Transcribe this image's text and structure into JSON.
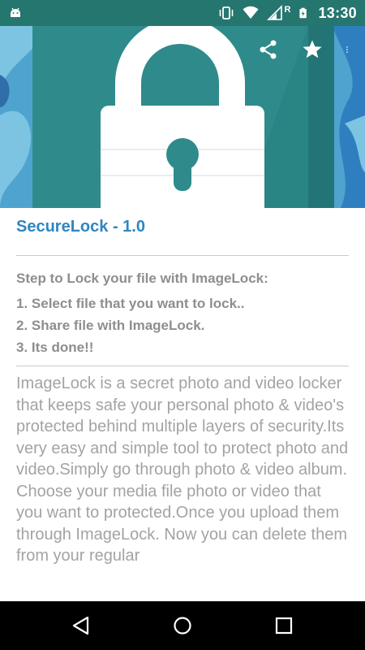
{
  "status_bar": {
    "time": "13:30",
    "icons": [
      "android-debug-icon",
      "vibrate-icon",
      "wifi-icon",
      "signal-icon",
      "roaming-r-label",
      "battery-charging-icon"
    ],
    "roaming_label": "R"
  },
  "header": {
    "background_colors": {
      "sky": "#5fb1d4",
      "panel": "#2a8a86",
      "lock": "#ffffff",
      "keyhole": "#2a8a86"
    },
    "actions": [
      "share-icon",
      "star-icon",
      "more-vert-icon"
    ]
  },
  "content": {
    "title": "SecureLock - 1.0",
    "steps_heading": "Step to Lock your file with ImageLock:",
    "steps": [
      "1. Select file that you want to lock..",
      "2. Share file with ImageLock.",
      "3. Its done!!"
    ],
    "description": [
      "ImageLock is a secret photo and video locker that keeps safe your personal photo & video's protected behind multiple layers of security.Its very easy and simple tool to protect photo and video.Simply go through photo & video album.",
      "Choose your media file photo or video that you want to protected.Once you upload them through ImageLock. Now you can delete them from your regular"
    ]
  },
  "colors": {
    "status_bar": "#25766f",
    "title": "#2f86c0",
    "text_gray": "#8e8e8e",
    "desc_gray": "#a3a3a3",
    "nav_bar": "#000000"
  },
  "nav_bar": {
    "buttons": [
      "back-icon",
      "home-icon",
      "recents-icon"
    ]
  }
}
